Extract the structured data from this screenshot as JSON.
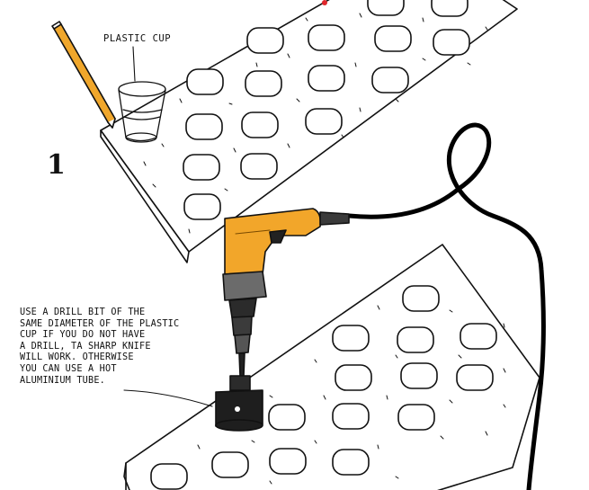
{
  "step": {
    "number": "1"
  },
  "labels": {
    "plastic_cup": "PLASTIC CUP"
  },
  "instructions": {
    "lines": [
      "USE A DRILL BIT OF THE",
      "SAME DIAMETER OF THE PLASTIC",
      "CUP IF YOU DO NOT HAVE",
      "A DRILL, TA SHARP KNIFE",
      "WILL WORK. OTHERWISE",
      "YOU CAN USE A HOT",
      "ALUMINIUM TUBE."
    ]
  },
  "colors": {
    "drill_body": "#f2a62a",
    "drill_dark": "#3a3a3a",
    "cord": "#000000",
    "ink": "#111111",
    "accent_dot": "#e0262b"
  },
  "icons": [
    "pencil-icon",
    "plastic-cup-icon",
    "power-drill-icon",
    "hole-saw-icon",
    "power-cord-icon"
  ]
}
